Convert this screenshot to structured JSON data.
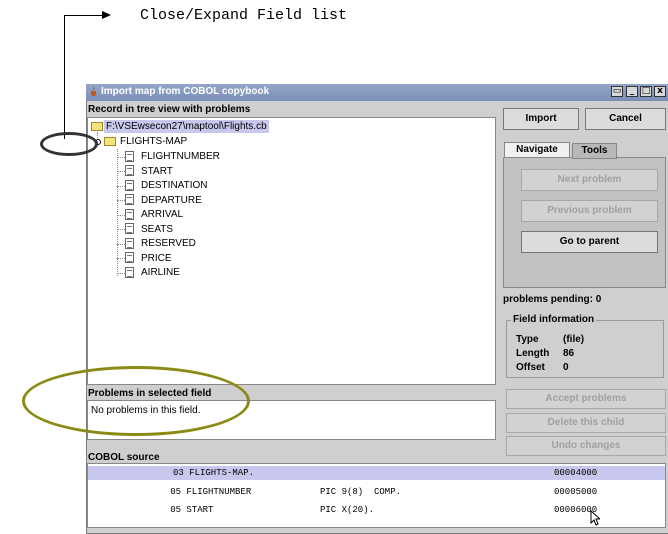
{
  "annotation": {
    "callout_text": "Close/Expand Field list"
  },
  "window": {
    "title": "Import map from COBOL copybook",
    "controls": [
      "▭",
      "_",
      "□",
      "x"
    ]
  },
  "tree_section": {
    "label": "Record in tree view with problems",
    "root_path": "F:\\VSEwsecon27\\maptool\\Flights.cb",
    "map_node": "FLIGHTS-MAP",
    "fields": [
      "FLIGHTNUMBER",
      "START",
      "DESTINATION",
      "DEPARTURE",
      "ARRIVAL",
      "SEATS",
      "RESERVED",
      "PRICE",
      "AIRLINE"
    ]
  },
  "problems": {
    "label": "Problems in selected field",
    "message": "No problems in this field."
  },
  "buttons": {
    "import": "Import",
    "cancel": "Cancel",
    "next_problem": "Next problem",
    "previous_problem": "Previous problem",
    "go_to_parent": "Go to parent",
    "accept_problems": "Accept problems",
    "delete_child": "Delete this child",
    "undo_changes": "Undo changes"
  },
  "tabs": {
    "navigate": "Navigate",
    "tools": "Tools"
  },
  "status": {
    "problems_pending": "problems pending: 0"
  },
  "field_info": {
    "title": "Field information",
    "type_label": "Type",
    "type_value": "(file)",
    "length_label": "Length",
    "length_value": "86",
    "offset_label": "Offset",
    "offset_value": "0"
  },
  "cobol": {
    "label": "COBOL source",
    "lines": [
      {
        "code": "03 FLIGHTS-MAP.",
        "pic": "",
        "seq": "00004000"
      },
      {
        "code": "   05 FLIGHTNUMBER",
        "pic": "PIC 9(8)  COMP.",
        "seq": "00005000"
      },
      {
        "code": "   05 START",
        "pic": "PIC X(20).",
        "seq": "00006000"
      }
    ]
  },
  "colors": {
    "titlebar": "#8096c0",
    "selection": "#c8c8ee",
    "highlight_ellipse": "#8c8a17",
    "marker_ellipse": "#333333"
  }
}
